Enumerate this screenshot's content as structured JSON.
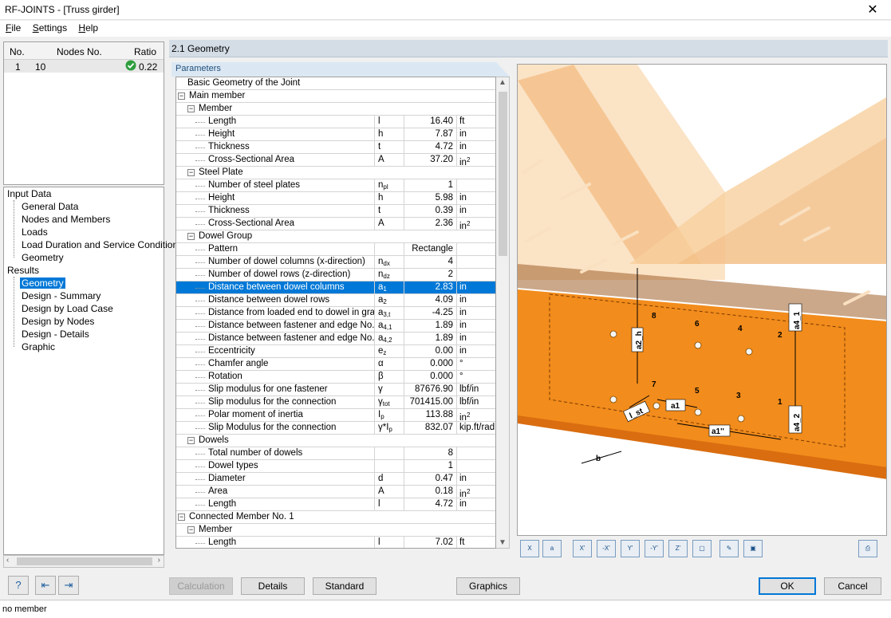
{
  "window": {
    "title": "RF-JOINTS - [Truss girder]",
    "close_glyph": "✕"
  },
  "menu": [
    {
      "label": "File",
      "accel": "F",
      "rest": "ile"
    },
    {
      "label": "Settings",
      "accel": "S",
      "rest": "ettings"
    },
    {
      "label": "Help",
      "accel": "H",
      "rest": "elp"
    }
  ],
  "nav_table": {
    "headers": {
      "no": "No.",
      "nodes": "Nodes No.",
      "ratio": "Ratio"
    },
    "rows": [
      {
        "no": "1",
        "nodes": "10",
        "ratio": "0.22",
        "status_icon": "check-circle-icon"
      }
    ]
  },
  "nav_tree": {
    "input_data": {
      "label": "Input Data",
      "children": [
        "General Data",
        "Nodes and Members",
        "Loads",
        "Load Duration and Service Conditions",
        "Geometry"
      ]
    },
    "results": {
      "label": "Results",
      "children": [
        "Geometry",
        "Design - Summary",
        "Design by Load Case",
        "Design by Nodes",
        "Design - Details",
        "Graphic"
      ],
      "selected": "Geometry"
    }
  },
  "section": {
    "title": "2.1 Geometry",
    "params_label": "Parameters"
  },
  "grid_rows": [
    {
      "level": 0,
      "type": "title",
      "name": "Basic Geometry of the Joint"
    },
    {
      "level": 0,
      "type": "group",
      "name": "Main member"
    },
    {
      "level": 1,
      "type": "group",
      "name": "Member"
    },
    {
      "level": 2,
      "type": "row",
      "name": "Length",
      "sym": "l",
      "val": "16.40",
      "unit": "ft"
    },
    {
      "level": 2,
      "type": "row",
      "name": "Height",
      "sym": "h",
      "val": "7.87",
      "unit": "in"
    },
    {
      "level": 2,
      "type": "row",
      "name": "Thickness",
      "sym": "t",
      "val": "4.72",
      "unit": "in"
    },
    {
      "level": 2,
      "type": "row",
      "name": "Cross-Sectional Area",
      "sym": "A",
      "val": "37.20",
      "unit": "in",
      "unit_sup": "2"
    },
    {
      "level": 1,
      "type": "group",
      "name": "Steel Plate"
    },
    {
      "level": 2,
      "type": "row",
      "name": "Number of steel plates",
      "sym": "n",
      "sym_sub": "pl",
      "val": "1",
      "unit": ""
    },
    {
      "level": 2,
      "type": "row",
      "name": "Height",
      "sym": "h",
      "val": "5.98",
      "unit": "in"
    },
    {
      "level": 2,
      "type": "row",
      "name": "Thickness",
      "sym": "t",
      "val": "0.39",
      "unit": "in"
    },
    {
      "level": 2,
      "type": "row",
      "name": "Cross-Sectional Area",
      "sym": "A",
      "val": "2.36",
      "unit": "in",
      "unit_sup": "2"
    },
    {
      "level": 1,
      "type": "group",
      "name": "Dowel Group"
    },
    {
      "level": 2,
      "type": "row",
      "name": "Pattern",
      "sym": "",
      "val": "Rectangle",
      "unit": ""
    },
    {
      "level": 2,
      "type": "row",
      "name": "Number of dowel columns (x-direction)",
      "sym": "n",
      "sym_sub": "dx",
      "val": "4",
      "unit": ""
    },
    {
      "level": 2,
      "type": "row",
      "name": "Number of dowel rows (z-direction)",
      "sym": "n",
      "sym_sub": "dz",
      "val": "2",
      "unit": ""
    },
    {
      "level": 2,
      "type": "row",
      "name": "Distance between dowel columns",
      "sym": "a",
      "sym_sub": "1",
      "val": "2.83",
      "unit": "in",
      "selected": true
    },
    {
      "level": 2,
      "type": "row",
      "name": "Distance between dowel rows",
      "sym": "a",
      "sym_sub": "2",
      "val": "4.09",
      "unit": "in"
    },
    {
      "level": 2,
      "type": "row",
      "name": "Distance from loaded end to dowel in grain",
      "sym": "a",
      "sym_sub": "3,t",
      "val": "-4.25",
      "unit": "in"
    },
    {
      "level": 2,
      "type": "row",
      "name": "Distance between fastener and edge No. 1",
      "sym": "a",
      "sym_sub": "4,1",
      "val": "1.89",
      "unit": "in"
    },
    {
      "level": 2,
      "type": "row",
      "name": "Distance between fastener and edge No. 2",
      "sym": "a",
      "sym_sub": "4,2",
      "val": "1.89",
      "unit": "in"
    },
    {
      "level": 2,
      "type": "row",
      "name": "Eccentricity",
      "sym": "e",
      "sym_sub": "z",
      "val": "0.00",
      "unit": "in"
    },
    {
      "level": 2,
      "type": "row",
      "name": "Chamfer angle",
      "sym": "α",
      "val": "0.000",
      "unit": "°"
    },
    {
      "level": 2,
      "type": "row",
      "name": "Rotation",
      "sym": "β",
      "val": "0.000",
      "unit": "°"
    },
    {
      "level": 2,
      "type": "row",
      "name": "Slip modulus for one fastener",
      "sym": "γ",
      "val": "87676.90",
      "unit": "lbf/in"
    },
    {
      "level": 2,
      "type": "row",
      "name": "Slip modulus for the connection",
      "sym": "γ",
      "sym_sub": "tot",
      "val": "701415.00",
      "unit": "lbf/in"
    },
    {
      "level": 2,
      "type": "row",
      "name": "Polar moment of inertia",
      "sym": "I",
      "sym_sub": "p",
      "val": "113.88",
      "unit": "in",
      "unit_sup": "2"
    },
    {
      "level": 2,
      "type": "row",
      "name": "Slip Modulus for the connection",
      "sym": "γ*I",
      "sym_sub": "p",
      "val": "832.07",
      "unit": "kip.ft/rad"
    },
    {
      "level": 1,
      "type": "group",
      "name": "Dowels"
    },
    {
      "level": 2,
      "type": "row",
      "name": "Total number of dowels",
      "sym": "",
      "val": "8",
      "unit": ""
    },
    {
      "level": 2,
      "type": "row",
      "name": "Dowel types",
      "sym": "",
      "val": "1",
      "unit": ""
    },
    {
      "level": 2,
      "type": "row",
      "name": "Diameter",
      "sym": "d",
      "val": "0.47",
      "unit": "in"
    },
    {
      "level": 2,
      "type": "row",
      "name": "Area",
      "sym": "A",
      "val": "0.18",
      "unit": "in",
      "unit_sup": "2"
    },
    {
      "level": 2,
      "type": "row",
      "name": "Length",
      "sym": "l",
      "val": "4.72",
      "unit": "in"
    },
    {
      "level": 0,
      "type": "group",
      "name": "Connected Member No. 1"
    },
    {
      "level": 1,
      "type": "group",
      "name": "Member"
    },
    {
      "level": 2,
      "type": "row",
      "name": "Length",
      "sym": "l",
      "val": "7.02",
      "unit": "ft"
    }
  ],
  "graphic": {
    "dim_labels": {
      "a2h": "a2_h",
      "a4_1": "a4_1",
      "a4_2": "a4_2",
      "a1": "a1",
      "a1pp": "a1''",
      "lst": "l_st",
      "b": "b"
    },
    "dowel_numbers": [
      "1",
      "2",
      "3",
      "4",
      "5",
      "6",
      "7",
      "8"
    ],
    "colors": {
      "beam": "#f28c1c",
      "beam_dark": "#d96d10",
      "chord": "#f7c98c",
      "background": "#ffffff"
    }
  },
  "graphic_toolbar": [
    {
      "name": "view-x-button",
      "glyph": "X"
    },
    {
      "name": "view-a-button",
      "glyph": "a"
    },
    {
      "name": "view-plus-x-button",
      "glyph": "X'"
    },
    {
      "name": "view-minus-x-button",
      "glyph": "-X'"
    },
    {
      "name": "view-plus-y-button",
      "glyph": "Y'"
    },
    {
      "name": "view-minus-y-button",
      "glyph": "-Y'"
    },
    {
      "name": "view-z-button",
      "glyph": "Z'"
    },
    {
      "name": "view-iso-button",
      "glyph": "▢"
    },
    {
      "name": "render-settings-button",
      "glyph": "✎"
    },
    {
      "name": "toggle-display-button",
      "glyph": "▣"
    },
    {
      "name": "print-button",
      "glyph": "⎙"
    }
  ],
  "buttons": {
    "calculation": "Calculation",
    "details": "Details",
    "standard": "Standard",
    "graphics": "Graphics",
    "ok": "OK",
    "cancel": "Cancel"
  },
  "status": "no member"
}
